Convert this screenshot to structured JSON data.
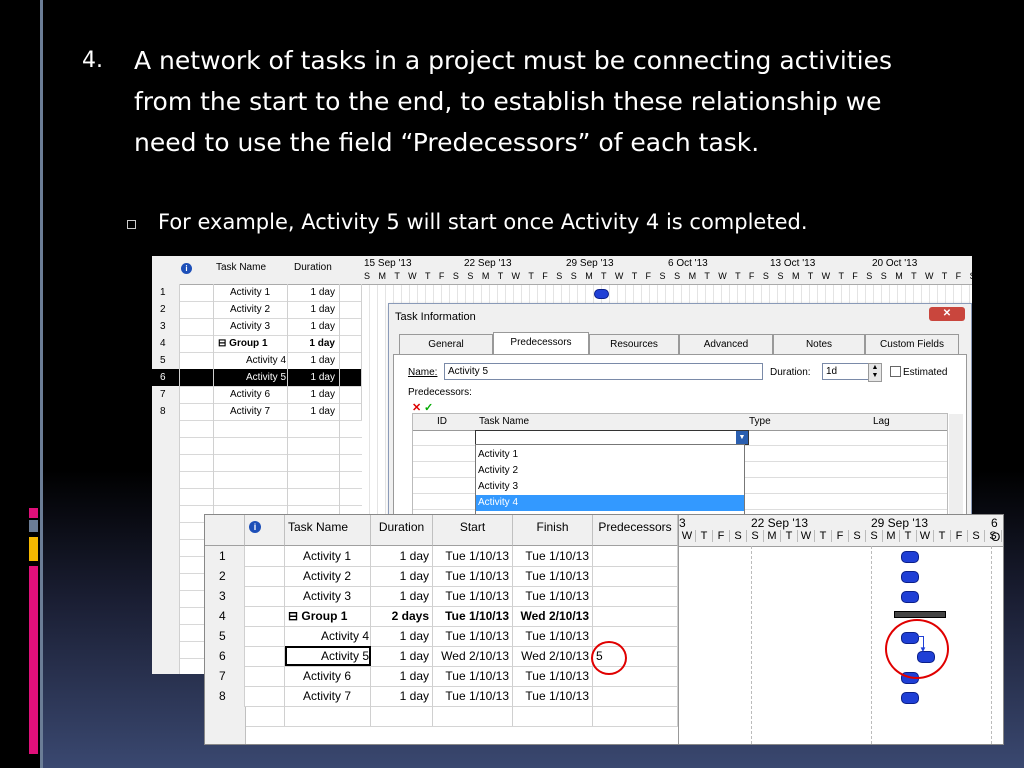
{
  "slide": {
    "item_number": "4.",
    "paragraph": "A network of tasks in a project must be connecting activities from the start to the end, to establish these relationship we need to use the field “Predecessors” of each task.",
    "sub_bullet": "For example, Activity 5 will start once Activity 4 is completed."
  },
  "back_shot": {
    "headers": {
      "task_name": "Task Name",
      "duration": "Duration"
    },
    "weeks": [
      "15 Sep '13",
      "22 Sep '13",
      "29 Sep '13",
      "6 Oct '13",
      "13 Oct '13",
      "20 Oct '13"
    ],
    "days": "S M T W T F S",
    "rows": [
      {
        "id": "1",
        "name": "Activity 1",
        "duration": "1 day"
      },
      {
        "id": "2",
        "name": "Activity 2",
        "duration": "1 day"
      },
      {
        "id": "3",
        "name": "Activity 3",
        "duration": "1 day"
      },
      {
        "id": "4",
        "name": "Group 1",
        "duration": "1 day"
      },
      {
        "id": "5",
        "name": "Activity 4",
        "duration": "1 day"
      },
      {
        "id": "6",
        "name": "Activity 5",
        "duration": "1 day"
      },
      {
        "id": "7",
        "name": "Activity 6",
        "duration": "1 day"
      },
      {
        "id": "8",
        "name": "Activity 7",
        "duration": "1 day"
      }
    ],
    "group_collapse_glyph": "⊟"
  },
  "dialog": {
    "title": "Task Information",
    "close": "✕",
    "tabs": [
      "General",
      "Predecessors",
      "Resources",
      "Advanced",
      "Notes",
      "Custom Fields"
    ],
    "active_tab": "Predecessors",
    "name_label": "Name:",
    "name_value": "Activity 5",
    "duration_label": "Duration:",
    "duration_value": "1d",
    "estimated_label": "Estimated",
    "predecessors_label": "Predecessors:",
    "columns": {
      "id": "ID",
      "task_name": "Task Name",
      "type": "Type",
      "lag": "Lag"
    },
    "dropdown_options": [
      "Activity 1",
      "Activity 2",
      "Activity 3",
      "Activity 4"
    ],
    "selected_option": "Activity 4"
  },
  "front_shot": {
    "headers": {
      "task_name": "Task Name",
      "duration": "Duration",
      "start": "Start",
      "finish": "Finish",
      "predecessors": "Predecessors"
    },
    "weeks": [
      "3",
      "22 Sep '13",
      "29 Sep '13",
      "6 O"
    ],
    "days": [
      "W",
      "T",
      "F",
      "S",
      "S",
      "M",
      "T",
      "W",
      "T",
      "F",
      "S",
      "S",
      "M",
      "T",
      "W",
      "T",
      "F",
      "S",
      "S"
    ],
    "rows": [
      {
        "id": "1",
        "name": "Activity 1",
        "duration": "1 day",
        "start": "Tue 1/10/13",
        "finish": "Tue 1/10/13",
        "pred": ""
      },
      {
        "id": "2",
        "name": "Activity 2",
        "duration": "1 day",
        "start": "Tue 1/10/13",
        "finish": "Tue 1/10/13",
        "pred": ""
      },
      {
        "id": "3",
        "name": "Activity 3",
        "duration": "1 day",
        "start": "Tue 1/10/13",
        "finish": "Tue 1/10/13",
        "pred": ""
      },
      {
        "id": "4",
        "name": "Group 1",
        "duration": "2 days",
        "start": "Tue 1/10/13",
        "finish": "Wed 2/10/13",
        "pred": ""
      },
      {
        "id": "5",
        "name": "Activity 4",
        "duration": "1 day",
        "start": "Tue 1/10/13",
        "finish": "Tue 1/10/13",
        "pred": ""
      },
      {
        "id": "6",
        "name": "Activity 5",
        "duration": "1 day",
        "start": "Wed 2/10/13",
        "finish": "Wed 2/10/13",
        "pred": "5"
      },
      {
        "id": "7",
        "name": "Activity 6",
        "duration": "1 day",
        "start": "Tue 1/10/13",
        "finish": "Tue 1/10/13",
        "pred": ""
      },
      {
        "id": "8",
        "name": "Activity 7",
        "duration": "1 day",
        "start": "Tue 1/10/13",
        "finish": "Tue 1/10/13",
        "pred": ""
      }
    ]
  },
  "colors": {
    "highlight_circle": "#e00000",
    "gantt_bar": "#1f3fd6",
    "selected_row": "#000000"
  }
}
